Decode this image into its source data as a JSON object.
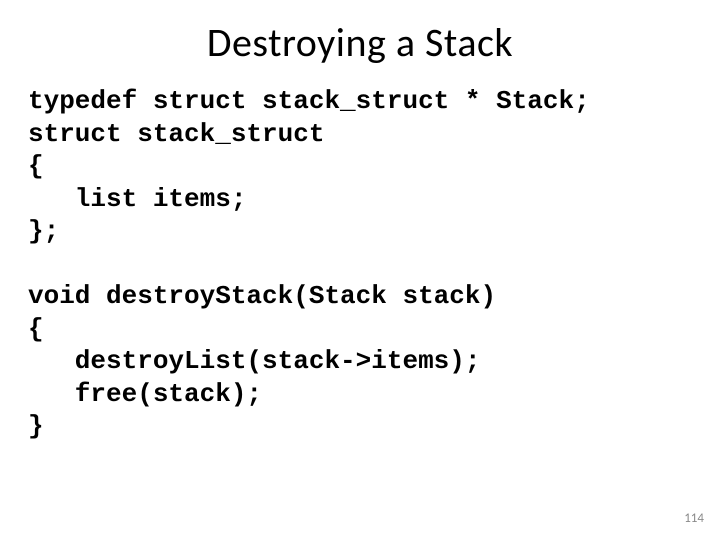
{
  "title": "Destroying a Stack",
  "code": "typedef struct stack_struct * Stack;\nstruct stack_struct\n{\n   list items;\n};\n\nvoid destroyStack(Stack stack)\n{\n   destroyList(stack->items);\n   free(stack);\n}",
  "page_number": "114"
}
